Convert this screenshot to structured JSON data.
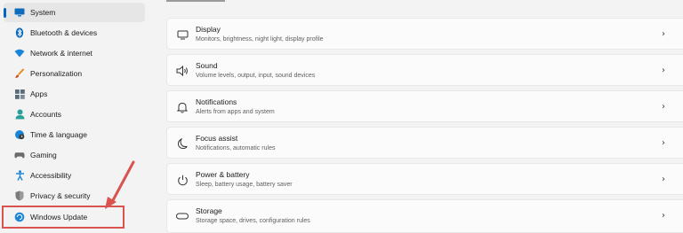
{
  "sidebar": {
    "items": [
      {
        "label": "System",
        "icon": "system-icon"
      },
      {
        "label": "Bluetooth & devices",
        "icon": "bluetooth-icon"
      },
      {
        "label": "Network & internet",
        "icon": "network-icon"
      },
      {
        "label": "Personalization",
        "icon": "brush-icon"
      },
      {
        "label": "Apps",
        "icon": "apps-icon"
      },
      {
        "label": "Accounts",
        "icon": "accounts-icon"
      },
      {
        "label": "Time & language",
        "icon": "globe-clock-icon"
      },
      {
        "label": "Gaming",
        "icon": "gaming-icon"
      },
      {
        "label": "Accessibility",
        "icon": "accessibility-icon"
      },
      {
        "label": "Privacy & security",
        "icon": "shield-icon"
      },
      {
        "label": "Windows Update",
        "icon": "windows-update-icon"
      }
    ]
  },
  "cards": [
    {
      "title": "Display",
      "subtitle": "Monitors, brightness, night light, display profile",
      "icon": "monitor-icon"
    },
    {
      "title": "Sound",
      "subtitle": "Volume levels, output, input, sound devices",
      "icon": "speaker-icon"
    },
    {
      "title": "Notifications",
      "subtitle": "Alerts from apps and system",
      "icon": "bell-icon"
    },
    {
      "title": "Focus assist",
      "subtitle": "Notifications, automatic rules",
      "icon": "moon-icon"
    },
    {
      "title": "Power & battery",
      "subtitle": "Sleep, battery usage, battery saver",
      "icon": "power-icon"
    },
    {
      "title": "Storage",
      "subtitle": "Storage space, drives, configuration rules",
      "icon": "storage-icon"
    }
  ],
  "colors": {
    "accent": "#0067c0",
    "annotation": "#d9534f"
  }
}
